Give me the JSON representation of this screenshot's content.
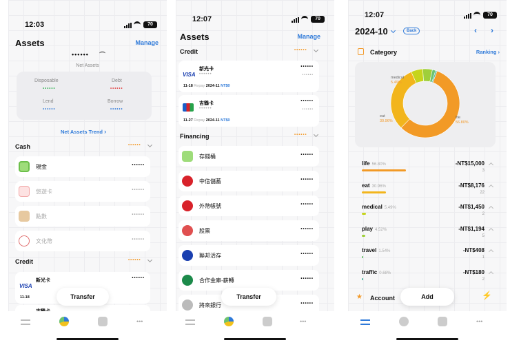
{
  "status": {
    "time1": "12:03",
    "time2": "12:07",
    "time3": "12:07",
    "battery": "70"
  },
  "colors": {
    "accent": "#2f7ad9",
    "orange": "#f39a2a",
    "donut_life": "#f29a26",
    "donut_eat": "#f2c21c",
    "donut_medical": "#b4d335",
    "donut_other": "#c8d6e5"
  },
  "screen1": {
    "title": "Assets",
    "manage": "Manage",
    "masked_total": "••••••",
    "net_assets_label": "Net Assets",
    "disposable": "Disposable",
    "debt": "Debt",
    "lend": "Lend",
    "borrow": "Borrow",
    "masked": "••••••",
    "trend_link": "Net Assets Trend",
    "cash_section": "Cash",
    "cash_items": [
      {
        "label": "現金",
        "icon": "cash-icon"
      },
      {
        "label": "悠遊卡",
        "icon": "card-icon"
      },
      {
        "label": "點數",
        "icon": "wallet-icon"
      },
      {
        "label": "文化幣",
        "icon": "coin-icon"
      }
    ],
    "credit_section": "Credit",
    "credit_card": {
      "name": "新光卡",
      "date": "11-18",
      "repay_text": "Repay"
    },
    "credit_card2": {
      "name": "吉鶴卡"
    },
    "transfer": "Transfer"
  },
  "screen2": {
    "title": "Assets",
    "manage": "Manage",
    "credit_section": "Credit",
    "cards": [
      {
        "name": "新光卡",
        "date": "11-18",
        "repay": "Repay",
        "month": "2024-11",
        "amount": "NT$0",
        "brand": "VISA"
      },
      {
        "name": "吉鶴卡",
        "date": "11-27",
        "repay": "Repay",
        "month": "2024-11",
        "amount": "NT$0",
        "brand": "JCB"
      }
    ],
    "financing_section": "Financing",
    "financing_items": [
      {
        "label": "存錢桶",
        "icon": "cash-icon"
      },
      {
        "label": "中信儲蓄",
        "icon": "bank-icon"
      },
      {
        "label": "外幣帳號",
        "icon": "bank-icon"
      },
      {
        "label": "股票",
        "icon": "stock-icon"
      },
      {
        "label": "聯邦活存",
        "icon": "bank-icon"
      },
      {
        "label": "合作金庫-薪轉",
        "icon": "bank-icon"
      },
      {
        "label": "將來銀行",
        "icon": "bank-icon"
      }
    ],
    "transfer": "Transfer"
  },
  "screen3": {
    "month": "2024-10",
    "back": "Back",
    "category": "Category",
    "ranking": "Ranking",
    "donut_labels": {
      "medical": "medical",
      "medical_pct": "5.49%",
      "eat": "eat",
      "eat_pct": "30.96%",
      "life": "life",
      "life_pct": "56.80%"
    },
    "chart_data": {
      "type": "pie",
      "categories": [
        "life",
        "eat",
        "medical",
        "play",
        "travel",
        "traffic"
      ],
      "values": [
        56.8,
        30.96,
        5.49,
        4.52,
        1.54,
        0.68
      ]
    },
    "rows": [
      {
        "name": "life",
        "pct": "56.80%",
        "amount": "-NT$15,000",
        "count": "3",
        "frac": 0.568,
        "color": "#f29a26"
      },
      {
        "name": "eat",
        "pct": "30.96%",
        "amount": "-NT$8,176",
        "count": "22",
        "frac": 0.3096,
        "color": "#f2b51c"
      },
      {
        "name": "medical",
        "pct": "5.49%",
        "amount": "-NT$1,450",
        "count": "2",
        "frac": 0.0549,
        "color": "#c6d41d"
      },
      {
        "name": "play",
        "pct": "4.52%",
        "amount": "-NT$1,194",
        "count": "5",
        "frac": 0.0452,
        "color": "#9fcf3a"
      },
      {
        "name": "travel",
        "pct": "1.54%",
        "amount": "-NT$408",
        "count": "1",
        "frac": 0.0154,
        "color": "#6cc270"
      },
      {
        "name": "traffic",
        "pct": "0.68%",
        "amount": "-NT$180",
        "count": "2",
        "frac": 0.0068,
        "color": "#4fb7a0"
      }
    ],
    "account": "Account",
    "add": "Add"
  }
}
